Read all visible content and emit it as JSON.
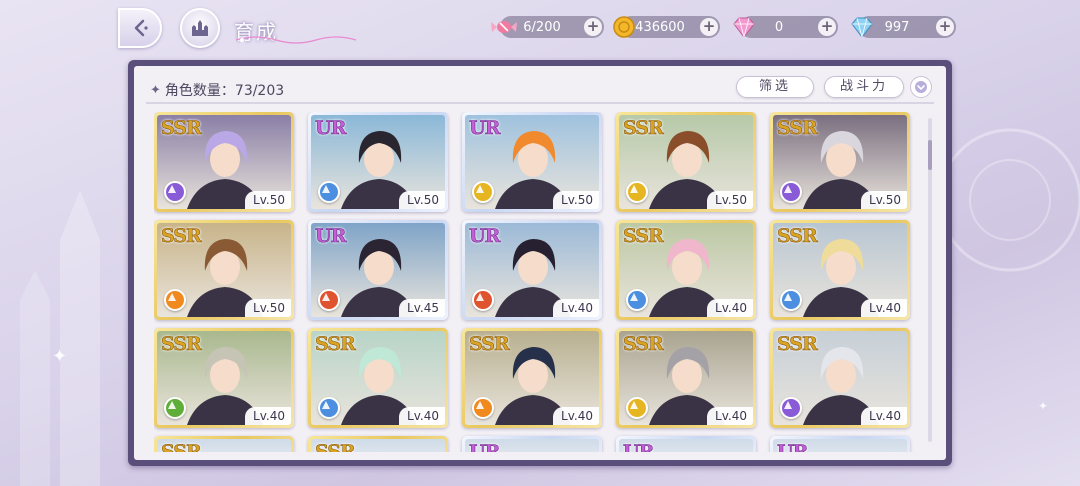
{
  "header": {
    "title": "育成",
    "resources": [
      {
        "icon": "candy-icon",
        "value": "6/200"
      },
      {
        "icon": "gold-coin-icon",
        "value": "436600"
      },
      {
        "icon": "pink-diamond-icon",
        "value": "0"
      },
      {
        "icon": "blue-diamond-icon",
        "value": "997"
      }
    ]
  },
  "panel": {
    "count_label": "角色数量：73/203",
    "filter_label": "筛选",
    "sort_label": "战斗力"
  },
  "colors": {
    "element_purple": "#8a5bd6",
    "element_blue": "#4c8fe0",
    "element_yellow": "#e6b522",
    "element_orange": "#f08a1e",
    "element_red": "#e0532f",
    "element_green": "#5fae3a"
  },
  "cards": [
    {
      "rarity": "SSR",
      "level": "Lv.50",
      "element": "purple",
      "hair": "#b9a7e6",
      "bg": "#8a7fa6"
    },
    {
      "rarity": "UR",
      "level": "Lv.50",
      "element": "blue",
      "hair": "#2a2630",
      "bg": "#8ab8d8"
    },
    {
      "rarity": "UR",
      "level": "Lv.50",
      "element": "yellow",
      "hair": "#f08a2c",
      "bg": "#9fc2de"
    },
    {
      "rarity": "SSR",
      "level": "Lv.50",
      "element": "yellow",
      "hair": "#8a4f2a",
      "bg": "#b6c9a8"
    },
    {
      "rarity": "SSR",
      "level": "Lv.50",
      "element": "purple",
      "hair": "#d9d6de",
      "bg": "#7a6f80"
    },
    {
      "rarity": "SSR",
      "level": "Lv.50",
      "element": "orange",
      "hair": "#8a5a34",
      "bg": "#c8b48a"
    },
    {
      "rarity": "UR",
      "level": "Lv.45",
      "element": "red",
      "hair": "#2b2433",
      "bg": "#7fa4c8"
    },
    {
      "rarity": "UR",
      "level": "Lv.40",
      "element": "red",
      "hair": "#262030",
      "bg": "#9cbad8"
    },
    {
      "rarity": "SSR",
      "level": "Lv.40",
      "element": "blue",
      "hair": "#f0b6cc",
      "bg": "#bcc8a4"
    },
    {
      "rarity": "SSR",
      "level": "Lv.40",
      "element": "blue",
      "hair": "#efdc9a",
      "bg": "#b8c6d2"
    },
    {
      "rarity": "SSR",
      "level": "Lv.40",
      "element": "green",
      "hair": "#c6c4b4",
      "bg": "#a9b88e"
    },
    {
      "rarity": "SSR",
      "level": "Lv.40",
      "element": "blue",
      "hair": "#bfe8d6",
      "bg": "#b8d4c8"
    },
    {
      "rarity": "SSR",
      "level": "Lv.40",
      "element": "orange",
      "hair": "#26304a",
      "bg": "#b8b090"
    },
    {
      "rarity": "SSR",
      "level": "Lv.40",
      "element": "yellow",
      "hair": "#a4a2a6",
      "bg": "#a9a490"
    },
    {
      "rarity": "SSR",
      "level": "Lv.40",
      "element": "purple",
      "hair": "#e4e6ec",
      "bg": "#c6cfd8"
    }
  ],
  "partial_row": [
    {
      "rarity": "SSR"
    },
    {
      "rarity": "SSR"
    },
    {
      "rarity": "UR"
    },
    {
      "rarity": "UR"
    },
    {
      "rarity": "UR"
    }
  ]
}
